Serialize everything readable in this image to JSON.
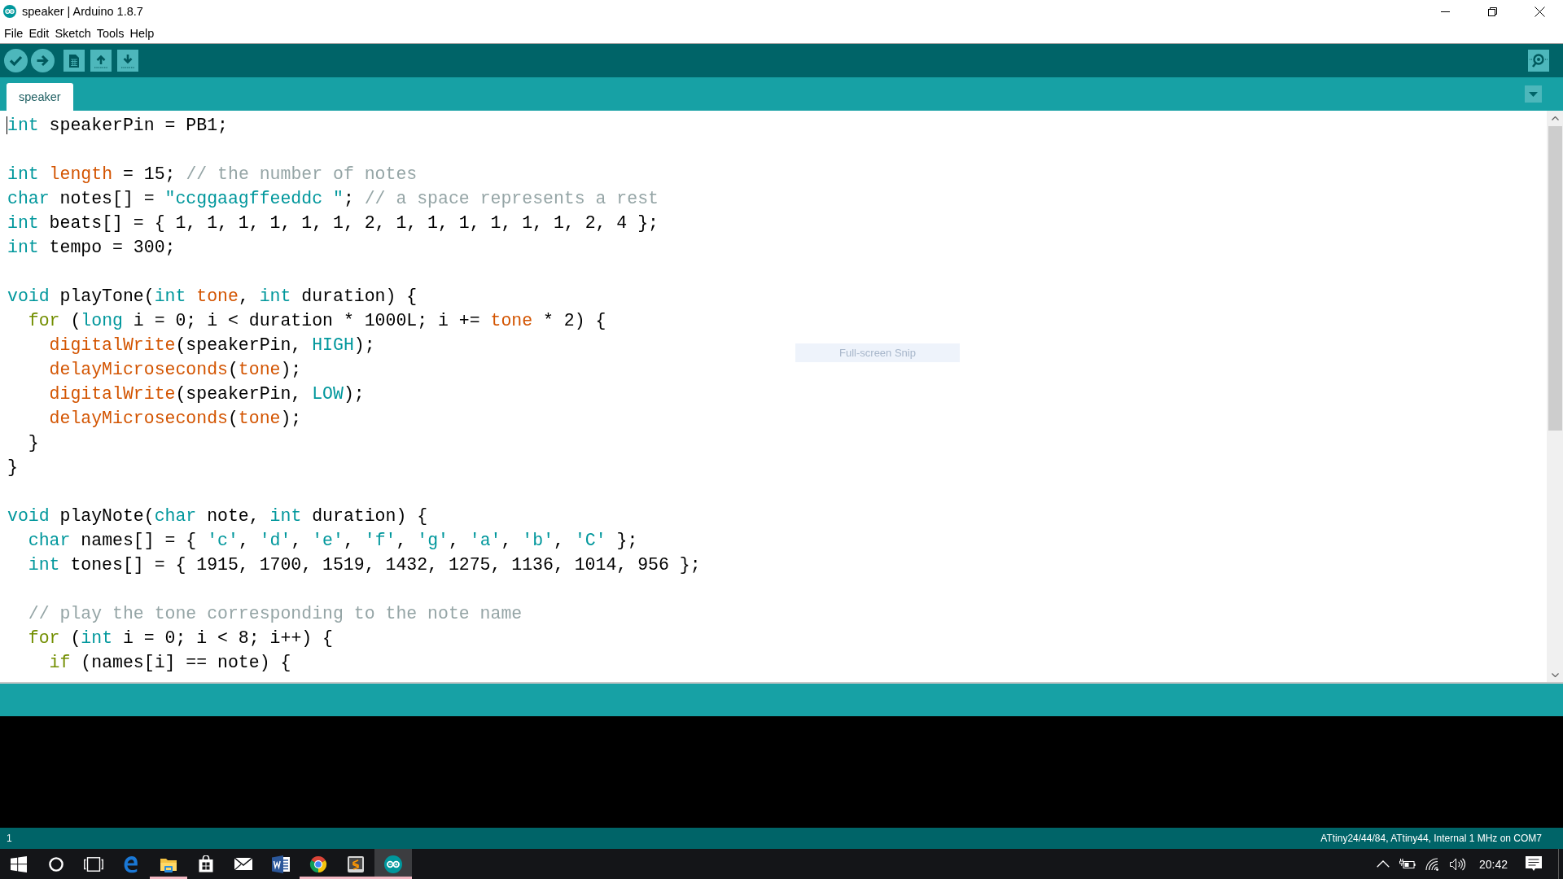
{
  "window": {
    "title": "speaker | Arduino 1.8.7"
  },
  "menu": [
    "File",
    "Edit",
    "Sketch",
    "Tools",
    "Help"
  ],
  "tabs": [
    {
      "label": "speaker",
      "selected": true
    }
  ],
  "editor": {
    "lines": [
      {
        "kind": "code",
        "cursor": true,
        "tokens": [
          {
            "text": "int",
            "kind": "keyword"
          },
          {
            "text": " speakerPin = PB1;",
            "kind": "plain"
          }
        ]
      },
      {
        "kind": "blank",
        "cursor": false
      },
      {
        "kind": "code",
        "cursor": false,
        "tokens": [
          {
            "text": "int",
            "kind": "keyword"
          },
          {
            "text": " length",
            "kind": "function"
          },
          {
            "text": " = 15; ",
            "kind": "plain"
          },
          {
            "text": "// the number of notes",
            "kind": "comment"
          }
        ]
      },
      {
        "kind": "code",
        "cursor": false,
        "tokens": [
          {
            "text": "char",
            "kind": "keyword"
          },
          {
            "text": " notes[] = ",
            "kind": "plain"
          },
          {
            "text": "\"ccggaagffeeddc \"",
            "kind": "string"
          },
          {
            "text": "; ",
            "kind": "plain"
          },
          {
            "text": "// a space represents a rest",
            "kind": "comment"
          }
        ]
      },
      {
        "kind": "code",
        "cursor": false,
        "tokens": [
          {
            "text": "int",
            "kind": "keyword"
          },
          {
            "text": " beats[] = { 1, 1, 1, 1, 1, 1, 2, 1, 1, 1, 1, 1, 1, 2, 4 };",
            "kind": "plain"
          }
        ]
      },
      {
        "kind": "code",
        "cursor": false,
        "tokens": [
          {
            "text": "int",
            "kind": "keyword"
          },
          {
            "text": " tempo = 300;",
            "kind": "plain"
          }
        ]
      },
      {
        "kind": "blank",
        "cursor": false
      },
      {
        "kind": "code",
        "cursor": false,
        "tokens": [
          {
            "text": "void",
            "kind": "keyword"
          },
          {
            "text": " playTone(",
            "kind": "plain"
          },
          {
            "text": "int",
            "kind": "keyword"
          },
          {
            "text": " tone",
            "kind": "function"
          },
          {
            "text": ", ",
            "kind": "plain"
          },
          {
            "text": "int",
            "kind": "keyword"
          },
          {
            "text": " duration) {",
            "kind": "plain"
          }
        ]
      },
      {
        "kind": "code",
        "cursor": false,
        "tokens": [
          {
            "text": "  for",
            "kind": "control"
          },
          {
            "text": " (",
            "kind": "plain"
          },
          {
            "text": "long",
            "kind": "keyword"
          },
          {
            "text": " i = 0; i < duration * 1000L; i += ",
            "kind": "plain"
          },
          {
            "text": "tone",
            "kind": "function"
          },
          {
            "text": " * 2) {",
            "kind": "plain"
          }
        ]
      },
      {
        "kind": "code",
        "cursor": false,
        "tokens": [
          {
            "text": "    digitalWrite",
            "kind": "function"
          },
          {
            "text": "(speakerPin, ",
            "kind": "plain"
          },
          {
            "text": "HIGH",
            "kind": "keyword"
          },
          {
            "text": ");",
            "kind": "plain"
          }
        ]
      },
      {
        "kind": "code",
        "cursor": false,
        "tokens": [
          {
            "text": "    delayMicroseconds",
            "kind": "function"
          },
          {
            "text": "(",
            "kind": "plain"
          },
          {
            "text": "tone",
            "kind": "function"
          },
          {
            "text": ");",
            "kind": "plain"
          }
        ]
      },
      {
        "kind": "code",
        "cursor": false,
        "tokens": [
          {
            "text": "    digitalWrite",
            "kind": "function"
          },
          {
            "text": "(speakerPin, ",
            "kind": "plain"
          },
          {
            "text": "LOW",
            "kind": "keyword"
          },
          {
            "text": ");",
            "kind": "plain"
          }
        ]
      },
      {
        "kind": "code",
        "cursor": false,
        "tokens": [
          {
            "text": "    delayMicroseconds",
            "kind": "function"
          },
          {
            "text": "(",
            "kind": "plain"
          },
          {
            "text": "tone",
            "kind": "function"
          },
          {
            "text": ");",
            "kind": "plain"
          }
        ]
      },
      {
        "kind": "code",
        "cursor": false,
        "tokens": [
          {
            "text": "  }",
            "kind": "plain"
          }
        ]
      },
      {
        "kind": "code",
        "cursor": false,
        "tokens": [
          {
            "text": "}",
            "kind": "plain"
          }
        ]
      },
      {
        "kind": "blank",
        "cursor": false
      },
      {
        "kind": "code",
        "cursor": false,
        "tokens": [
          {
            "text": "void",
            "kind": "keyword"
          },
          {
            "text": " playNote(",
            "kind": "plain"
          },
          {
            "text": "char",
            "kind": "keyword"
          },
          {
            "text": " note, ",
            "kind": "plain"
          },
          {
            "text": "int",
            "kind": "keyword"
          },
          {
            "text": " duration) {",
            "kind": "plain"
          }
        ]
      },
      {
        "kind": "code",
        "cursor": false,
        "tokens": [
          {
            "text": "  char",
            "kind": "keyword"
          },
          {
            "text": " names[] = { ",
            "kind": "plain"
          },
          {
            "text": "'c'",
            "kind": "string"
          },
          {
            "text": ", ",
            "kind": "plain"
          },
          {
            "text": "'d'",
            "kind": "string"
          },
          {
            "text": ", ",
            "kind": "plain"
          },
          {
            "text": "'e'",
            "kind": "string"
          },
          {
            "text": ", ",
            "kind": "plain"
          },
          {
            "text": "'f'",
            "kind": "string"
          },
          {
            "text": ", ",
            "kind": "plain"
          },
          {
            "text": "'g'",
            "kind": "string"
          },
          {
            "text": ", ",
            "kind": "plain"
          },
          {
            "text": "'a'",
            "kind": "string"
          },
          {
            "text": ", ",
            "kind": "plain"
          },
          {
            "text": "'b'",
            "kind": "string"
          },
          {
            "text": ", ",
            "kind": "plain"
          },
          {
            "text": "'C'",
            "kind": "string"
          },
          {
            "text": " };",
            "kind": "plain"
          }
        ]
      },
      {
        "kind": "code",
        "cursor": false,
        "tokens": [
          {
            "text": "  int",
            "kind": "keyword"
          },
          {
            "text": " tones[] = { 1915, 1700, 1519, 1432, 1275, 1136, 1014, 956 };",
            "kind": "plain"
          }
        ]
      },
      {
        "kind": "blank",
        "cursor": false
      },
      {
        "kind": "code",
        "cursor": false,
        "tokens": [
          {
            "text": "  // play the tone corresponding to the note name",
            "kind": "comment"
          }
        ]
      },
      {
        "kind": "code",
        "cursor": false,
        "tokens": [
          {
            "text": "  for",
            "kind": "control"
          },
          {
            "text": " (",
            "kind": "plain"
          },
          {
            "text": "int",
            "kind": "keyword"
          },
          {
            "text": " i = 0; i < 8; i++) {",
            "kind": "plain"
          }
        ]
      },
      {
        "kind": "code",
        "cursor": false,
        "tokens": [
          {
            "text": "    if",
            "kind": "control"
          },
          {
            "text": " (names[i] == note) {",
            "kind": "plain"
          }
        ]
      }
    ]
  },
  "snip_tooltip": {
    "label": "Full-screen Snip"
  },
  "status_bar": {
    "line": "1",
    "board": "ATtiny24/44/84, ATtiny44, Internal 1 MHz on COM7"
  },
  "taskbar": {
    "apps": [
      {
        "running": false,
        "selected": false
      },
      {
        "running": true,
        "selected": false
      },
      {
        "running": false,
        "selected": false
      },
      {
        "running": false,
        "selected": false
      },
      {
        "running": false,
        "selected": false
      },
      {
        "running": true,
        "selected": false
      },
      {
        "running": true,
        "selected": false
      },
      {
        "running": true,
        "selected": true
      }
    ],
    "clock": "20:42"
  }
}
